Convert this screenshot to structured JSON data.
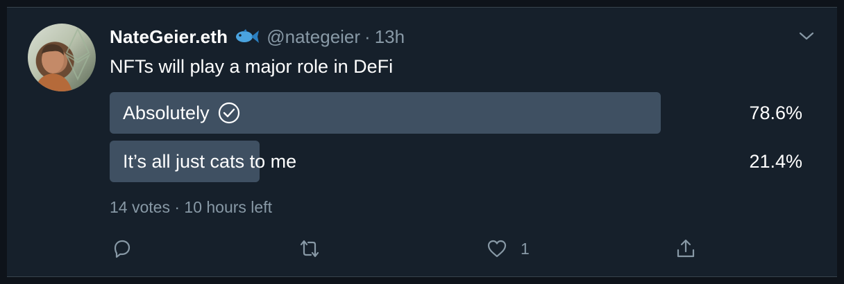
{
  "tweet": {
    "display_name": "NateGeier.eth",
    "handle": "@nategeier",
    "separator": "·",
    "time": "13h",
    "text": "NFTs will play a major role in DeFi"
  },
  "poll": {
    "options": [
      {
        "label": "Absolutely",
        "percent": "78.6%",
        "fraction": 0.786,
        "selected": true
      },
      {
        "label": "It’s all just cats to me",
        "percent": "21.4%",
        "fraction": 0.214,
        "selected": false
      }
    ],
    "votes": "14 votes",
    "meta_separator": " · ",
    "time_left": "10 hours left"
  },
  "actions": {
    "reply_icon": "reply-icon",
    "retweet_icon": "retweet-icon",
    "like_icon": "heart-icon",
    "like_count": "1",
    "share_icon": "share-icon"
  },
  "colors": {
    "background": "#16202b",
    "poll_fill": "#3f5062",
    "secondary_text": "#8899a6",
    "fish": "#4aa3df"
  }
}
